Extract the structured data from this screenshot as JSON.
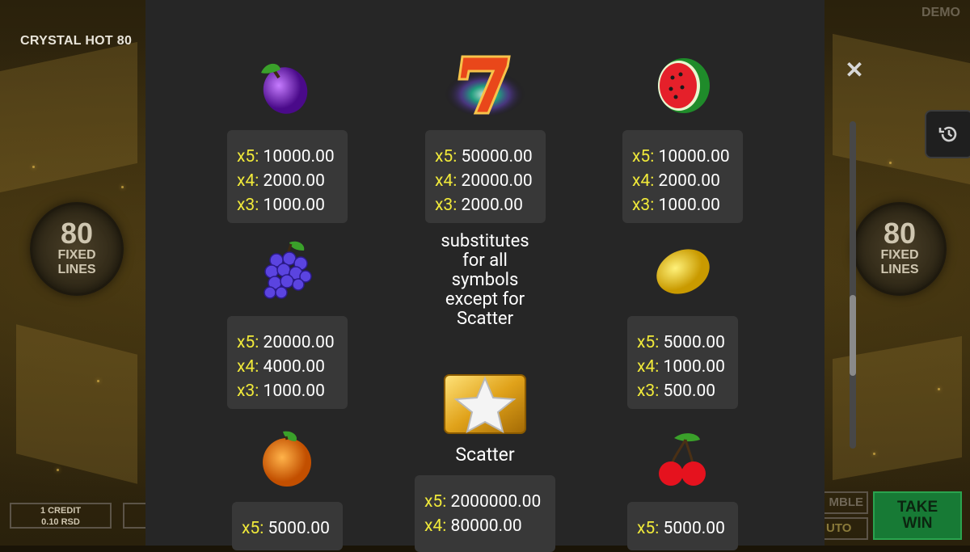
{
  "game": {
    "title": "CRYSTAL HOT 80",
    "mode": "DEMO"
  },
  "lines": {
    "count": "80",
    "line1": "FIXED",
    "line2": "LINES"
  },
  "bottom": {
    "credit_line1": "1 CREDIT",
    "credit_line2": "0.10 RSD",
    "gamble_label": "MBLE",
    "auto_label": "UTO",
    "take_win_line1": "TAKE",
    "take_win_line2": "WIN"
  },
  "paytable": {
    "close_icon": "close-icon",
    "history_icon": "history-icon",
    "wild_description": "substitutes for all symbols except for Scatter",
    "scatter_label": "Scatter",
    "symbols": [
      {
        "id": "plum",
        "icon": "plum-icon",
        "rows": [
          [
            "x5:",
            "10000.00"
          ],
          [
            "x4:",
            "2000.00"
          ],
          [
            "x3:",
            "1000.00"
          ]
        ]
      },
      {
        "id": "seven",
        "icon": "seven-icon",
        "rows": [
          [
            "x5:",
            "50000.00"
          ],
          [
            "x4:",
            "20000.00"
          ],
          [
            "x3:",
            "2000.00"
          ]
        ]
      },
      {
        "id": "watermelon",
        "icon": "watermelon-icon",
        "rows": [
          [
            "x5:",
            "10000.00"
          ],
          [
            "x4:",
            "2000.00"
          ],
          [
            "x3:",
            "1000.00"
          ]
        ]
      },
      {
        "id": "grapes",
        "icon": "grapes-icon",
        "rows": [
          [
            "x5:",
            "20000.00"
          ],
          [
            "x4:",
            "4000.00"
          ],
          [
            "x3:",
            "1000.00"
          ]
        ]
      },
      {
        "id": "lemon",
        "icon": "lemon-icon",
        "rows": [
          [
            "x5:",
            "5000.00"
          ],
          [
            "x4:",
            "1000.00"
          ],
          [
            "x3:",
            "500.00"
          ]
        ]
      },
      {
        "id": "orange",
        "icon": "orange-icon",
        "rows": [
          [
            "x5:",
            "5000.00"
          ]
        ]
      },
      {
        "id": "scatter",
        "icon": "star-scatter-icon",
        "rows": [
          [
            "x5:",
            "2000000.00"
          ],
          [
            "x4:",
            "80000.00"
          ]
        ]
      },
      {
        "id": "cherry",
        "icon": "cherry-icon",
        "rows": [
          [
            "x5:",
            "5000.00"
          ]
        ]
      }
    ]
  },
  "colors": {
    "panel_bg": "#262626",
    "paybox_bg": "#383838",
    "multiplier_yellow": "#f0e93a",
    "take_win_green": "#177a35"
  }
}
